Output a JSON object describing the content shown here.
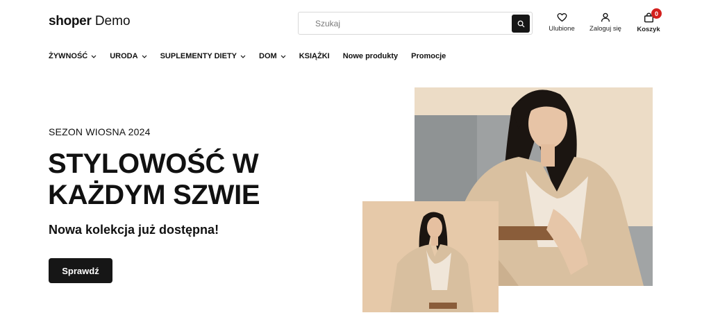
{
  "header": {
    "logo_bold": "shoper",
    "logo_regular": "Demo",
    "search_placeholder": "Szukaj",
    "favorites_label": "Ulubione",
    "login_label": "Zaloguj się",
    "cart_label": "Koszyk",
    "cart_count": "0"
  },
  "nav": {
    "items": [
      {
        "label": "ŻYWNOŚĆ",
        "dropdown": true
      },
      {
        "label": "URODA",
        "dropdown": true
      },
      {
        "label": "SUPLEMENTY DIETY",
        "dropdown": true
      },
      {
        "label": "DOM",
        "dropdown": true
      },
      {
        "label": "KSIĄŻKI",
        "dropdown": false
      },
      {
        "label": "Nowe produkty",
        "dropdown": false
      },
      {
        "label": "Promocje",
        "dropdown": false
      }
    ]
  },
  "hero": {
    "subtitle": "SEZON WIOSNA 2024",
    "title_line1": "STYLOWOŚĆ W",
    "title_line2": "KAŻDYM SZWIE",
    "description": "Nowa kolekcja już dostępna!",
    "cta_label": "Sprawdź"
  },
  "colors": {
    "accent_dark": "#161616",
    "badge_red": "#d3201e",
    "photo_background": "#ecdcc6"
  },
  "icons": {
    "search": "search-icon",
    "favorites": "heart-icon",
    "login": "user-icon",
    "cart": "shopping-bag-icon",
    "dropdown": "chevron-down-icon"
  }
}
